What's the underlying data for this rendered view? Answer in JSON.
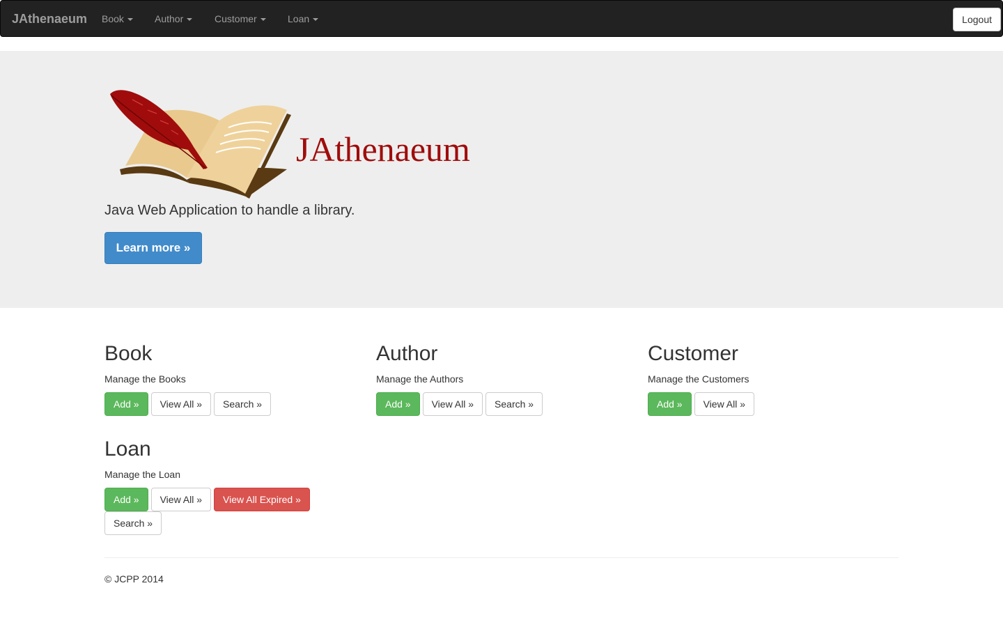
{
  "navbar": {
    "brand": "JAthenaeum",
    "menus": [
      {
        "label": "Book"
      },
      {
        "label": "Author"
      },
      {
        "label": "Customer"
      },
      {
        "label": "Loan"
      }
    ],
    "logout_label": "Logout"
  },
  "jumbotron": {
    "logo_text": "JAthenaeum",
    "tagline": "Java Web Application to handle a library.",
    "learn_more_label": "Learn more »"
  },
  "sections": {
    "book": {
      "title": "Book",
      "description": "Manage the Books",
      "add_label": "Add »",
      "view_all_label": "View All »",
      "search_label": "Search »"
    },
    "author": {
      "title": "Author",
      "description": "Manage the Authors",
      "add_label": "Add »",
      "view_all_label": "View All »",
      "search_label": "Search »"
    },
    "customer": {
      "title": "Customer",
      "description": "Manage the Customers",
      "add_label": "Add »",
      "view_all_label": "View All »"
    },
    "loan": {
      "title": "Loan",
      "description": "Manage the Loan",
      "add_label": "Add »",
      "view_all_label": "View All »",
      "view_expired_label": "View All Expired »",
      "search_label": "Search »"
    }
  },
  "footer": {
    "copyright": "© JCPP 2014"
  },
  "colors": {
    "navbar_bg": "#222222",
    "jumbotron_bg": "#eeeeee",
    "primary": "#428bca",
    "success": "#5cb85c",
    "danger": "#d9534f",
    "logo_red": "#a00c0c"
  },
  "icons": {
    "logo": "quill-and-book-logo",
    "dropdown": "caret-down-icon"
  }
}
